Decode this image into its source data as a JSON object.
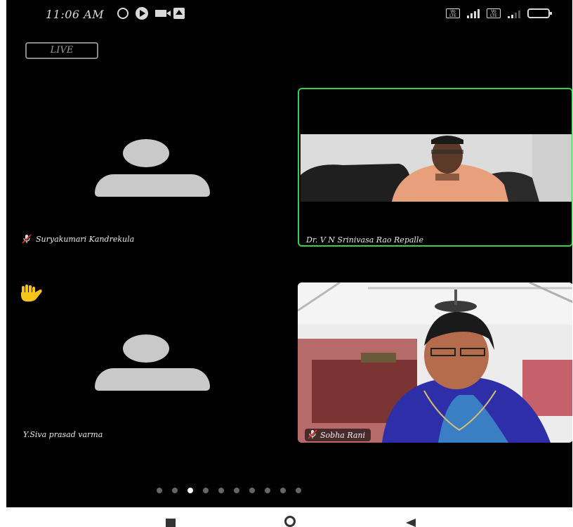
{
  "status_bar": {
    "time": "11:06 AM",
    "icons_left": [
      "alarm-icon",
      "play-icon",
      "video-icon",
      "upload-icon"
    ],
    "icons_right": [
      "volte-icon",
      "signal-icon",
      "volte-icon",
      "signal-icon",
      "battery-icon"
    ],
    "volte_text": "Vo LTE"
  },
  "live_badge": "LIVE",
  "participants": [
    {
      "name": "Suryakumari Kandrekula",
      "video": false,
      "muted": true
    },
    {
      "name": "Dr. V N Srinivasa Rao Repalle",
      "video": true,
      "muted": false,
      "active_speaker": true
    },
    {
      "name": "Y.Siva prasad varma",
      "video": false,
      "muted": false,
      "hand_raised": true
    },
    {
      "name": "Sobha Rani",
      "video": true,
      "muted": true
    }
  ],
  "pagination": {
    "total": 10,
    "current_index": 2
  },
  "nav_bar": [
    "recents-button",
    "home-button",
    "back-button"
  ],
  "colors": {
    "active_border": "#33d04a",
    "avatar": "#c9c9c9",
    "background": "#000000",
    "hand": "#f5c518"
  }
}
